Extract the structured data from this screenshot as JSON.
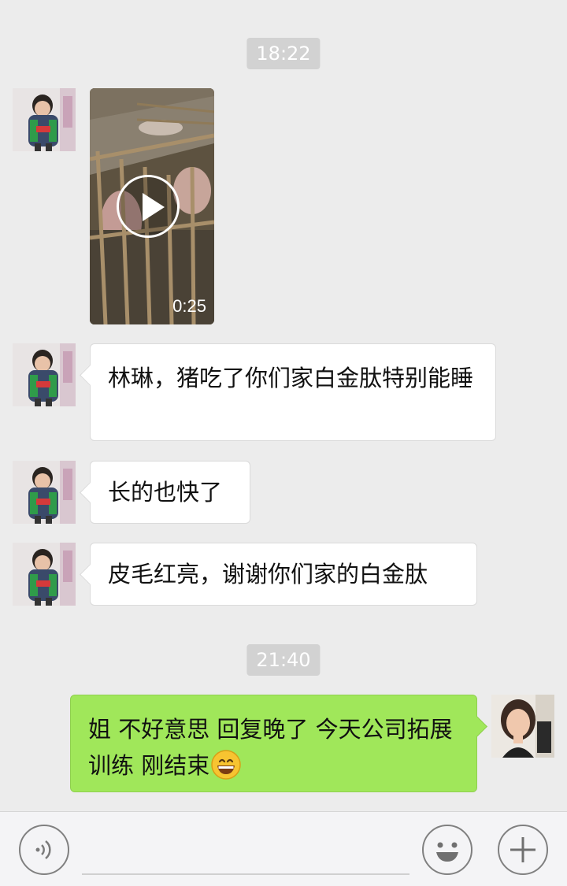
{
  "timestamps": [
    "18:22",
    "21:40"
  ],
  "video": {
    "duration": "0:25"
  },
  "messages": [
    {
      "side": "in",
      "text": "林琳，猪吃了你们家白金肽特别能睡"
    },
    {
      "side": "in",
      "text": "长的也快了"
    },
    {
      "side": "in",
      "text": "皮毛红亮，谢谢你们家的白金肽"
    },
    {
      "side": "out",
      "text": "姐 不好意思 回复晚了 今天公司拓展训练 刚结束",
      "emoji": "grinning-face-emoji"
    }
  ],
  "toolbar": {
    "voice_icon": "voice-icon",
    "emoji_icon": "smiley-icon",
    "more_icon": "plus-icon"
  },
  "colors": {
    "background": "#ececec",
    "incoming_bubble": "#ffffff",
    "outgoing_bubble": "#a0e75a",
    "timestamp_pill": "#d2d2d2"
  }
}
